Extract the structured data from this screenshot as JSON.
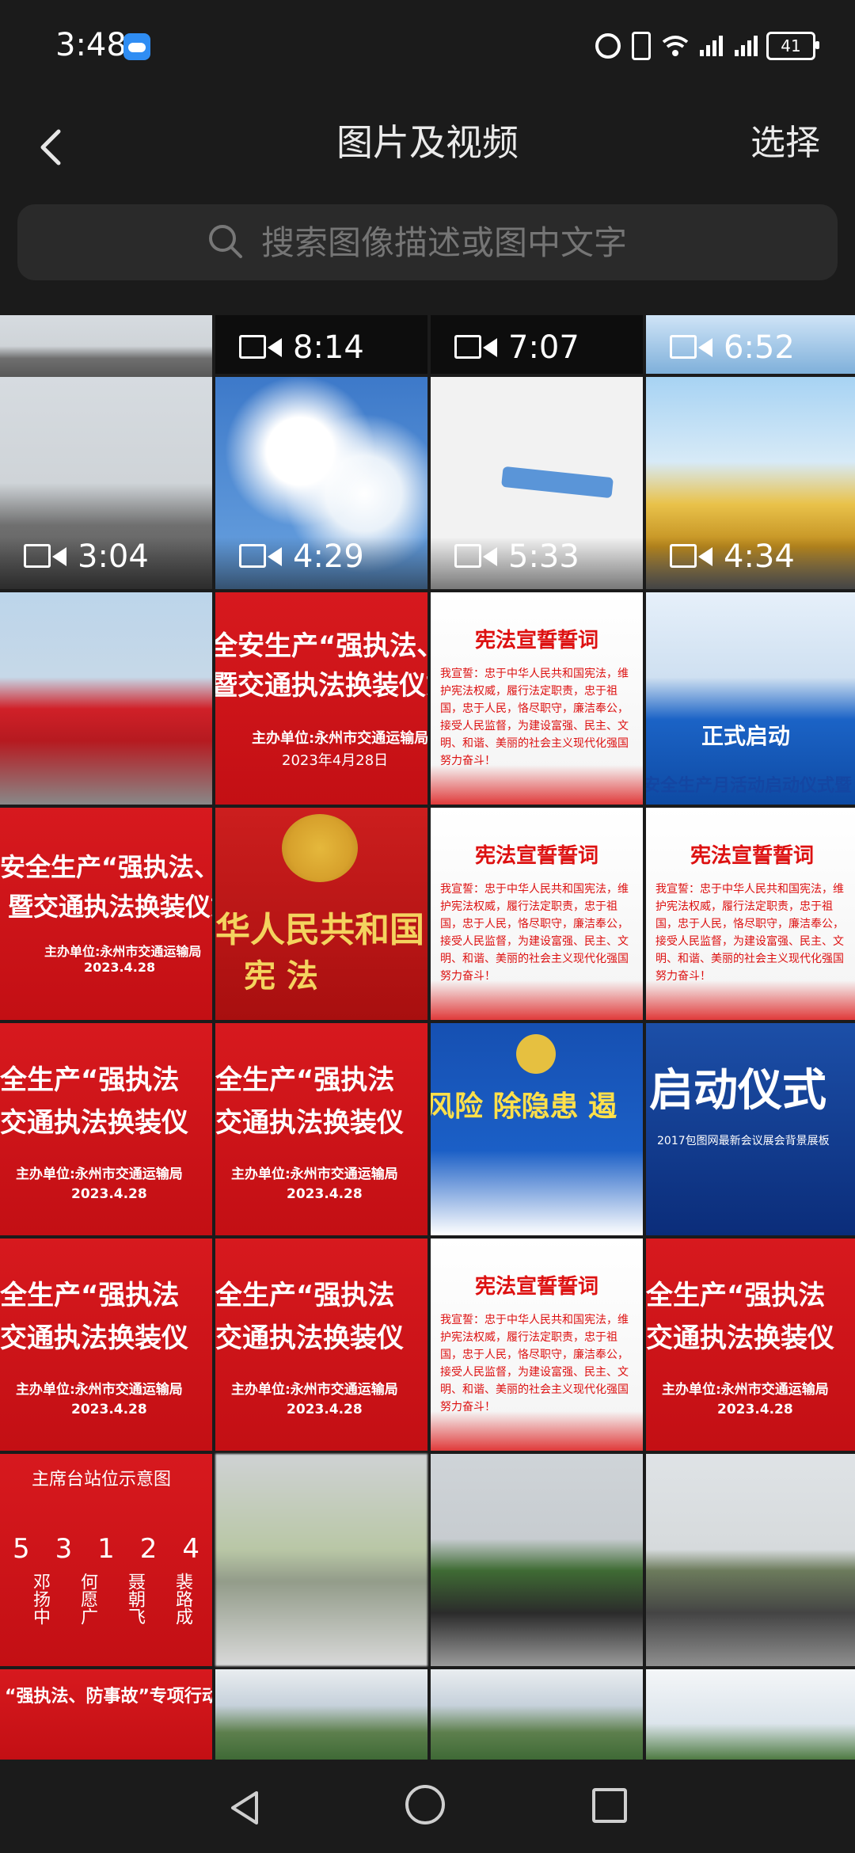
{
  "status_bar": {
    "time": "3:48",
    "battery": "41",
    "icons": [
      "weather-icon",
      "alarm-icon",
      "vibrate-icon",
      "wifi-icon",
      "signal-icon",
      "signal-icon",
      "battery-icon"
    ]
  },
  "header": {
    "title": "图片及视频",
    "select_label": "选择",
    "back_icon": "chevron-left-icon"
  },
  "search": {
    "placeholder": "搜索图像描述或图中文字",
    "icon": "search-icon"
  },
  "grid": {
    "videos": [
      "8:14",
      "7:07",
      "6:52",
      "3:04",
      "4:29",
      "5:33",
      "4:34"
    ],
    "texts": {
      "t1_title": "全安生产“强执法、",
      "t1_sub": "暨交通执法换装仪式",
      "t1_org": "主办单位:永州市交通运输局",
      "t1_date": "2023年4月28日",
      "constitution_title": "宪法宣誓誓词",
      "constitution_body": "我宣誓：忠于中华人民共和国宪法，维护宪法权威，履行法定职责，忠于祖国，忠于人民，恪尽职守，廉洁奉公，接受人民监督，为建设富强、民主、文明、和谐、美丽的社会主义现代化强国努力奋斗！",
      "start_label": "正式启动",
      "caption_a": "安全生产月活动启动仪式暨",
      "t2_title": "安全生产“强执法、防",
      "t2_sub": "暨交通执法换装仪式",
      "t2_org": "主办单位:永州市交通运输局",
      "t2_date": "2023.4.28",
      "emblem_title": "华人民共和国",
      "emblem_sub": "宪  法",
      "t3_title": "全生产“强执法",
      "t3_sub": "交通执法换装仪",
      "t3_org": "主办单位:永州市交通运输局",
      "t3_date": "2023.4.28",
      "risk_text": "风险 除隐患 遏",
      "ceremony_text": "启动仪式",
      "ceremony_sub": "2017包图网最新会议展会背景展板",
      "station_title": "主席台站位示意图",
      "station_names": [
        "5",
        "3",
        "1",
        "2",
        "4"
      ],
      "station_people": [
        "邓扬中",
        "何愿广",
        "聂朝飞",
        "裴路成"
      ],
      "banner_bottom": "“强执法、防事故”专项行动启动暨执法换装仪式"
    }
  }
}
